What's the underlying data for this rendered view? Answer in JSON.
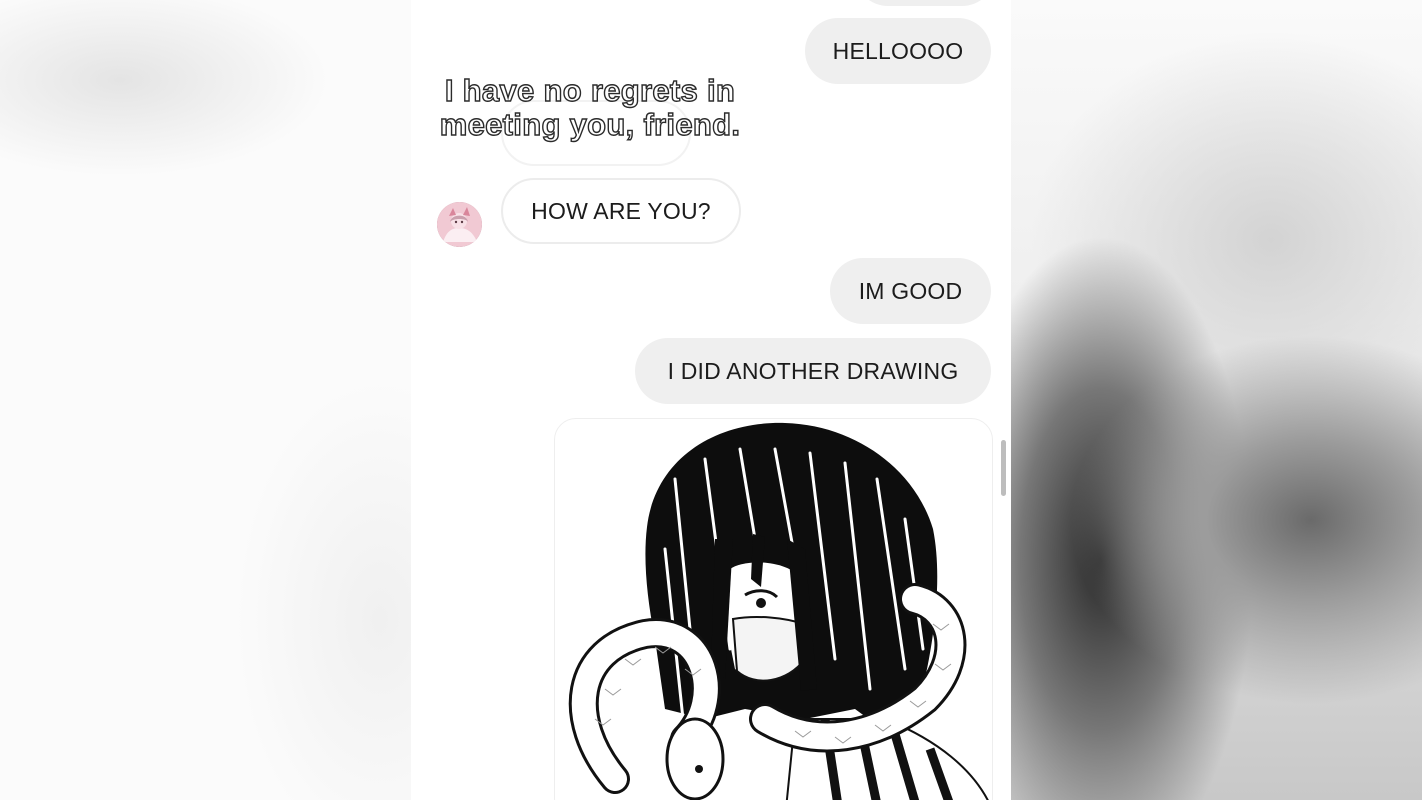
{
  "messages": [
    {
      "id": "hellooo",
      "text": "HELLOOOO",
      "direction": "sent"
    },
    {
      "id": "how_are_you",
      "text": "HOW ARE YOU?",
      "direction": "received"
    },
    {
      "id": "im_good",
      "text": "IM GOOD",
      "direction": "sent"
    },
    {
      "id": "drawing",
      "text": "I DID ANOTHER DRAWING",
      "direction": "sent"
    }
  ],
  "overlay_caption": "I have no regrets in meeting you, friend.",
  "colors": {
    "sent_bubble": "#efefef",
    "received_bubble_border": "#ececec",
    "text": "#1c1c1c"
  },
  "icons": {
    "avatar": "contact-avatar"
  }
}
